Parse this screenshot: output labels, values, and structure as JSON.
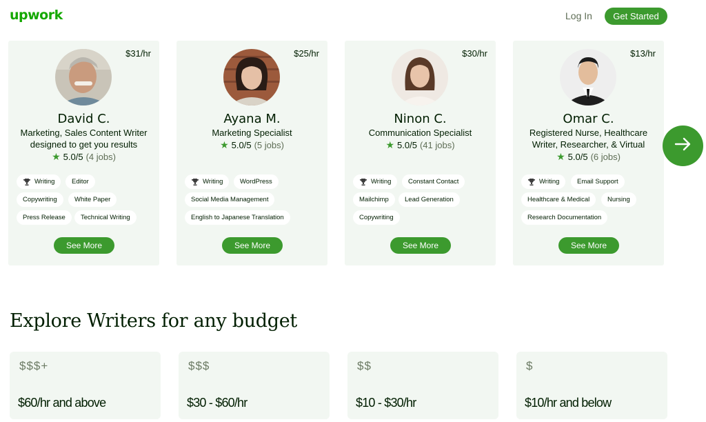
{
  "header": {
    "logo": "upwork",
    "login": "Log In",
    "get_started": "Get Started"
  },
  "freelancers": [
    {
      "name": "David C.",
      "rate": "$31/hr",
      "title": "Marketing, Sales Content Writer designed to get you results",
      "rating": "5.0/5",
      "jobs": "(4 jobs)",
      "tags": [
        "Writing",
        "Editor",
        "Copywriting",
        "White Paper",
        "Press Release",
        "Technical Writing"
      ],
      "see_more": "See More"
    },
    {
      "name": "Ayana M.",
      "rate": "$25/hr",
      "title": "Marketing Specialist",
      "rating": "5.0/5",
      "jobs": "(5 jobs)",
      "tags": [
        "Writing",
        "WordPress",
        "Social Media Management",
        "English to Japanese Translation"
      ],
      "see_more": "See More"
    },
    {
      "name": "Ninon C.",
      "rate": "$30/hr",
      "title": "Communication Specialist",
      "rating": "5.0/5",
      "jobs": "(41 jobs)",
      "tags": [
        "Writing",
        "Constant Contact",
        "Mailchimp",
        "Lead Generation",
        "Copywriting"
      ],
      "see_more": "See More"
    },
    {
      "name": "Omar C.",
      "rate": "$13/hr",
      "title": "Registered Nurse, Healthcare Writer, Researcher, & Virtual",
      "rating": "5.0/5",
      "jobs": "(6 jobs)",
      "tags": [
        "Writing",
        "Email Support",
        "Healthcare & Medical",
        "Nursing",
        "Research Documentation"
      ],
      "see_more": "See More"
    }
  ],
  "explore": {
    "title": "Explore Writers for any budget",
    "budgets": [
      {
        "symbol": "$$$+",
        "range": "$60/hr and above"
      },
      {
        "symbol": "$$$",
        "range": "$30 - $60/hr"
      },
      {
        "symbol": "$$",
        "range": "$10 - $30/hr"
      },
      {
        "symbol": "$",
        "range": "$10/hr and below"
      }
    ]
  },
  "colors": {
    "brand_green": "#14a800",
    "button_green": "#3c9a2e",
    "card_bg": "#f2f7f2"
  },
  "icons": {
    "tag_badge": "trophy-icon",
    "rating": "star-icon",
    "carousel_next": "arrow-right-icon"
  }
}
